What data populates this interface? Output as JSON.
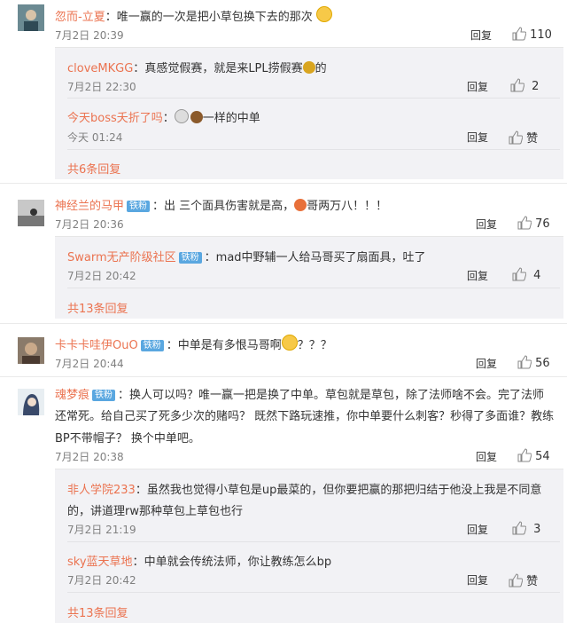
{
  "colors": {
    "name": "#eb7350",
    "text": "#333333",
    "meta": "#808080",
    "sub_bg": "#f2f2f5",
    "badge": "#5aa7e0"
  },
  "icons": [
    "thumb-up-icon",
    "smile-emoji-icon",
    "money-bag-emoji-icon",
    "poop-emoji-icon",
    "ghost-emoji-icon",
    "fire-emoji-icon",
    "grin-emoji-icon"
  ],
  "reply_label": "回复",
  "badge_label": "铁粉",
  "comments": [
    {
      "user": "忽而-立夏",
      "text": "唯一赢的一次是把小草包换下去的那次",
      "time": "7月2日 20:39",
      "likes": "110",
      "replies": [
        {
          "user": "cloveMKGG",
          "text_a": "真感觉假赛，就是来LPL捞假赛",
          "text_b": "的",
          "time": "7月2日 22:30",
          "likes": "2"
        },
        {
          "user": "今天boss夭折了吗",
          "text": "一样的中单",
          "time": "今天 01:24",
          "likes": "赞"
        }
      ],
      "more": "共6条回复"
    },
    {
      "user": "神经兰的马甲",
      "text_a": "出 三个面具伤害就是高，",
      "text_b": "哥两万八！！！",
      "time": "7月2日 20:36",
      "likes": "76",
      "replies": [
        {
          "user": "Swarm无产阶级社区",
          "text": "mad中野辅一人给马哥买了扇面具，吐了",
          "time": "7月2日 20:42",
          "likes": "4"
        }
      ],
      "more": "共13条回复"
    },
    {
      "user": "卡卡卡哇伊OuO",
      "text_a": "中单是有多恨马哥啊",
      "text_b": "？？？",
      "time": "7月2日 20:44",
      "likes": "56"
    },
    {
      "user": "魂梦痕",
      "line1": "换人可以吗？唯一赢一把是换了中单。草包就是草包，除了法师啥不会。完了法师",
      "line2": "还常死。给自己买了死多少次的赌吗？ 既然下路玩速推，你中单要什么刺客？秒得了多面谁？教练",
      "line3": "BP不带帽子？  换个中单吧。",
      "time": "7月2日 20:38",
      "likes": "54",
      "replies": [
        {
          "user": "非人学院233",
          "line1": "虽然我也觉得小草包是up最菜的，但你要把赢的那把归结于他没上我是不同意",
          "line2": "的，讲道理rw那种草包上草包也行",
          "time": "7月2日 21:19",
          "likes": "3"
        },
        {
          "user": "sky蓝天草地",
          "text": "中单就会传统法师，你让教练怎么bp",
          "time": "7月2日 20:42",
          "likes": "赞"
        }
      ],
      "more": "共13条回复"
    }
  ]
}
